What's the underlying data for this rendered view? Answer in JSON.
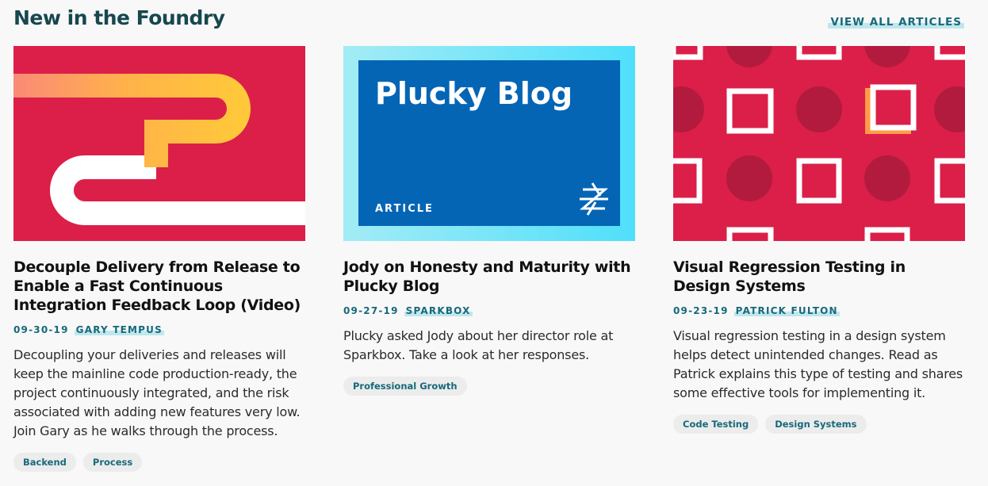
{
  "section": {
    "title": "New in the Foundry",
    "view_all": "VIEW ALL ARTICLES"
  },
  "articles": [
    {
      "title": "Decouple Delivery from Release to Enable a Fast Continuous Integration Feedback Loop (Video)",
      "date": "09-30-19",
      "author": "GARY TEMPUS",
      "excerpt": "Decoupling your deliveries and releases will keep the mainline code production-ready, the project continuously integrated, and the risk associated with adding new features very low. Join Gary as he walks through the process.",
      "tags": [
        "Backend",
        "Process"
      ],
      "thumb_icon": "pipe-illustration-icon"
    },
    {
      "title": "Jody on Honesty and Maturity with Plucky Blog",
      "date": "09-27-19",
      "author": "SPARKBOX",
      "excerpt": "Plucky asked Jody about her director role at Sparkbox. Take a look at her responses.",
      "tags": [
        "Professional Growth"
      ],
      "thumb_heading": "Plucky Blog",
      "thumb_label": "ARTICLE",
      "thumb_icon": "sparkbox-logo-icon"
    },
    {
      "title": "Visual Regression Testing in Design Systems",
      "date": "09-23-19",
      "author": "PATRICK FULTON",
      "excerpt": "Visual regression testing in a design system helps detect unintended changes. Read as Patrick explains this type of testing and shares some effective tools for implementing it.",
      "tags": [
        "Code Testing",
        "Design Systems"
      ],
      "thumb_icon": "circles-squares-pattern-icon"
    }
  ],
  "colors": {
    "heading": "#17474f",
    "link": "#17697a",
    "link_underline": "#bfe7ee",
    "card1_bg": "#dc1f48",
    "card2_bg": "#0565b5",
    "card3_bg": "#db1f48"
  }
}
